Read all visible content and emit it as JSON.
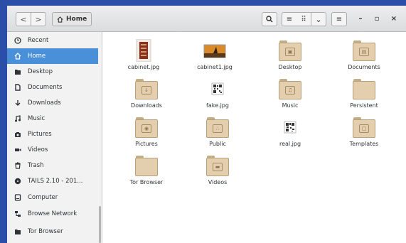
{
  "toolbar": {
    "back": "<",
    "forward": ">",
    "location": "Home",
    "list_view": "≡",
    "grid_view": "⠿",
    "view_menu": "⌄",
    "app_menu": "≡",
    "minimize": "–",
    "maximize": "▫",
    "close": "×"
  },
  "sidebar": {
    "items": [
      {
        "label": "Recent",
        "icon": "clock-icon",
        "active": false
      },
      {
        "label": "Home",
        "icon": "home-icon",
        "active": true
      },
      {
        "label": "Desktop",
        "icon": "desktop-icon",
        "active": false
      },
      {
        "label": "Documents",
        "icon": "document-icon",
        "active": false
      },
      {
        "label": "Downloads",
        "icon": "download-icon",
        "active": false
      },
      {
        "label": "Music",
        "icon": "music-icon",
        "active": false
      },
      {
        "label": "Pictures",
        "icon": "camera-icon",
        "active": false
      },
      {
        "label": "Videos",
        "icon": "video-icon",
        "active": false
      },
      {
        "label": "Trash",
        "icon": "trash-icon",
        "active": false
      },
      {
        "label": "TAILS 2.10 - 201...",
        "icon": "disc-icon",
        "active": false
      },
      {
        "label": "Computer",
        "icon": "drive-icon",
        "active": false
      },
      {
        "label": "Browse Network",
        "icon": "network-icon",
        "active": false
      },
      {
        "label": "Tor Browser",
        "icon": "folder-icon",
        "active": false
      }
    ]
  },
  "files": [
    {
      "name": "cabinet.jpg",
      "kind": "image-cabinet"
    },
    {
      "name": "cabinet1.jpg",
      "kind": "image-landscape"
    },
    {
      "name": "Desktop",
      "kind": "folder",
      "emblem": "▣"
    },
    {
      "name": "Documents",
      "kind": "folder",
      "emblem": "▤"
    },
    {
      "name": "Downloads",
      "kind": "folder",
      "emblem": "↓"
    },
    {
      "name": "fake.jpg",
      "kind": "image-qr"
    },
    {
      "name": "Music",
      "kind": "folder",
      "emblem": "♫"
    },
    {
      "name": "Persistent",
      "kind": "folder",
      "emblem": ""
    },
    {
      "name": "Pictures",
      "kind": "folder",
      "emblem": "◉"
    },
    {
      "name": "Public",
      "kind": "folder",
      "emblem": "∴"
    },
    {
      "name": "real.jpg",
      "kind": "image-qr"
    },
    {
      "name": "Templates",
      "kind": "folder",
      "emblem": "▢"
    },
    {
      "name": "Tor Browser",
      "kind": "folder",
      "emblem": ""
    },
    {
      "name": "Videos",
      "kind": "folder",
      "emblem": "▬"
    }
  ],
  "colors": {
    "selection": "#4a90d9",
    "folder": "#e3cfae",
    "background": "#2b4fa8"
  }
}
